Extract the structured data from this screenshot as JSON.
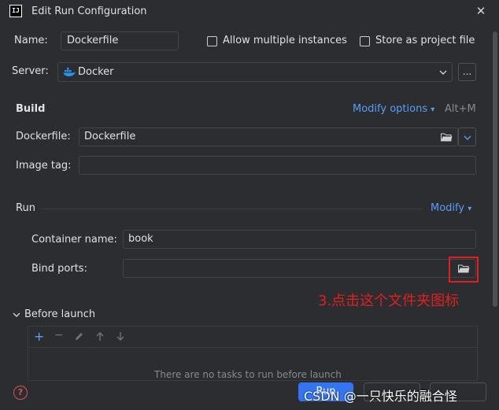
{
  "window": {
    "title": "Edit Run Configuration",
    "app_icon_text": "IJ"
  },
  "name_row": {
    "label": "Name:",
    "value": "Dockerfile",
    "allow_multiple": "Allow multiple instances",
    "store_as_project": "Store as project file"
  },
  "server_row": {
    "label": "Server:",
    "value": "Docker",
    "more_label": "..."
  },
  "build": {
    "heading": "Build",
    "modify_options": "Modify options",
    "shortcut": "Alt+M",
    "dockerfile_label": "Dockerfile:",
    "dockerfile_value": "Dockerfile",
    "image_tag_label": "Image tag:",
    "image_tag_value": ""
  },
  "run": {
    "heading": "Run",
    "modify": "Modify",
    "container_name_label": "Container name:",
    "container_name_value": "book",
    "bind_ports_label": "Bind ports:",
    "bind_ports_value": ""
  },
  "annotation": {
    "text": "3.点击这个文件夹图标"
  },
  "before_launch": {
    "heading": "Before launch",
    "empty_text": "There are no tasks to run before launch"
  },
  "footer": {
    "run_button": "Run",
    "watermark": "CSDN @一只快乐的融合怪"
  },
  "colors": {
    "accent": "#3574f0",
    "link": "#589df6",
    "annotation": "#e02020"
  },
  "icons": [
    "close-icon",
    "docker-icon",
    "chevron-down-icon",
    "folder-icon",
    "add-icon",
    "remove-icon",
    "edit-icon",
    "arrow-up-icon",
    "arrow-down-icon",
    "help-icon"
  ]
}
